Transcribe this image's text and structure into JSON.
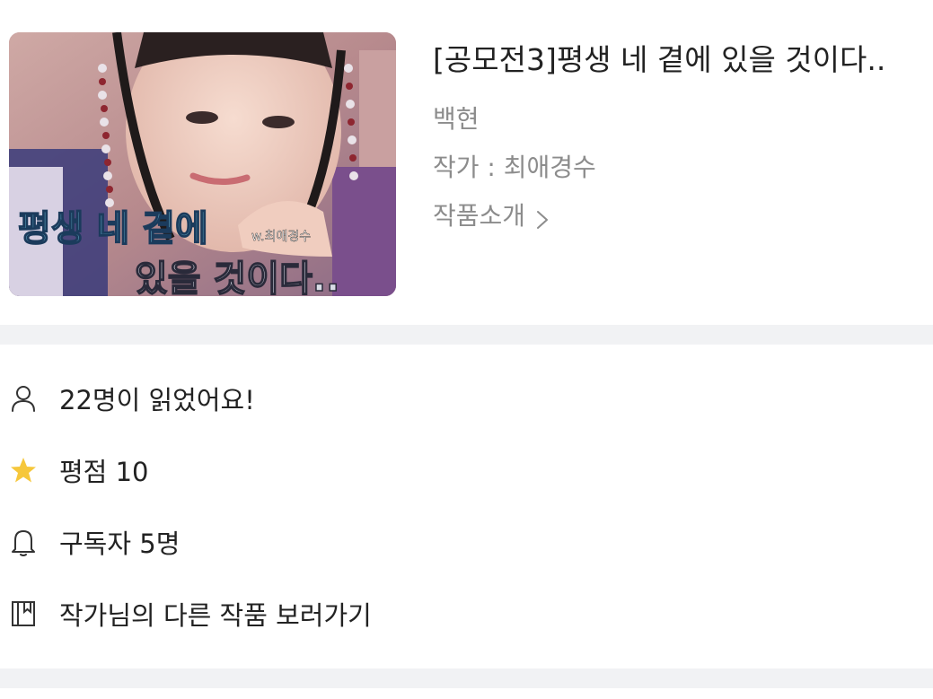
{
  "work": {
    "title": "[공모전3]평생 네 곁에 있을 것이다..",
    "tag": "백현",
    "author": "작가 : 최애경수",
    "intro_label": "작품소개",
    "cover": {
      "overlay_line1": "평생 네 곁에",
      "overlay_line2": "있을 것이다..",
      "watermark": "w.최애경수"
    }
  },
  "stats": {
    "readers": "22명이 읽었어요!",
    "rating": "평점 10",
    "subscribers": "구독자 5명",
    "other_works": "작가님의 다른 작품 보러가기"
  },
  "icons": {
    "readers": "person-icon",
    "rating": "star-icon",
    "subscribers": "bell-icon",
    "other_works": "book-icon",
    "intro": "chevron-right-icon"
  },
  "colors": {
    "star": "#f6c73b",
    "muted_text": "#8c8c8c",
    "divider": "#f1f2f4"
  }
}
